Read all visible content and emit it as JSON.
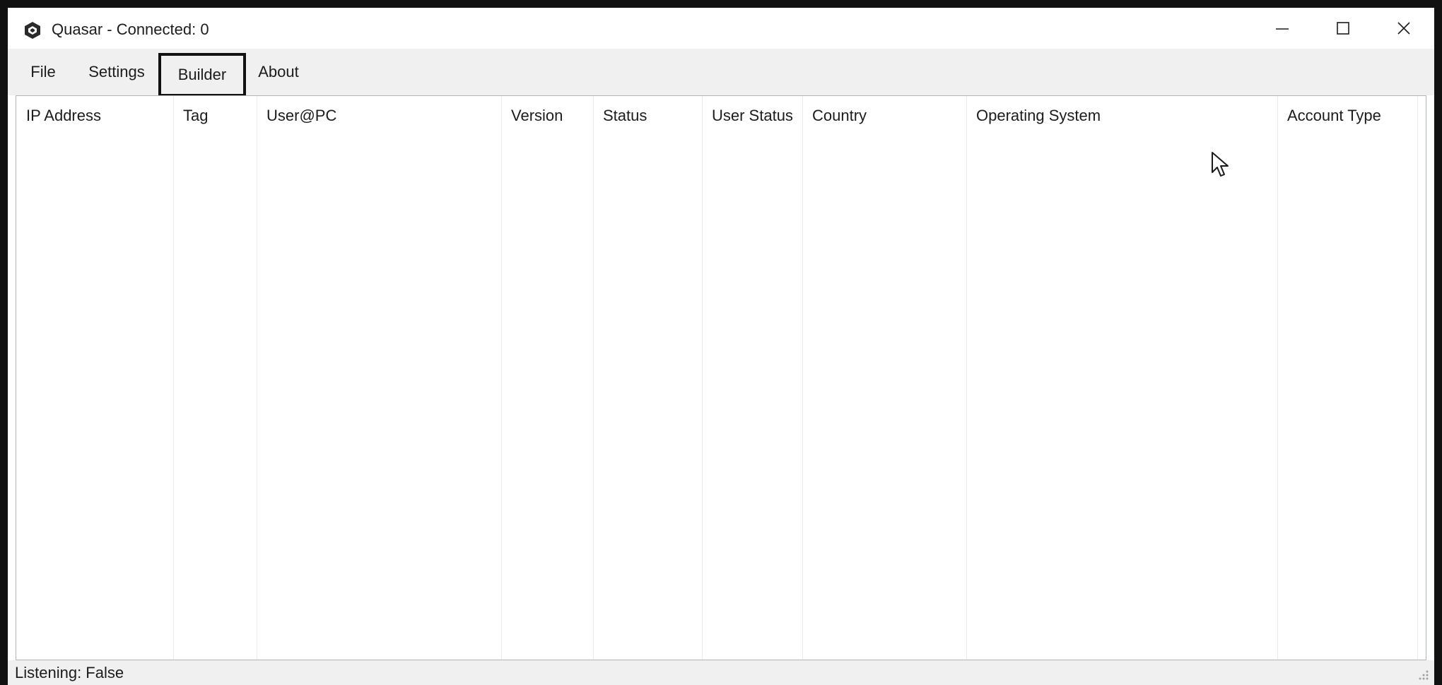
{
  "window": {
    "title": "Quasar - Connected: 0",
    "app_icon": "quasar-icon",
    "controls": [
      "minimize-icon",
      "maximize-icon",
      "close-icon"
    ]
  },
  "menu": {
    "items": [
      {
        "label": "File"
      },
      {
        "label": "Settings"
      },
      {
        "label": "Builder",
        "highlighted": true
      },
      {
        "label": "About"
      }
    ]
  },
  "clients_table": {
    "columns": [
      {
        "label": "IP Address"
      },
      {
        "label": "Tag"
      },
      {
        "label": "User@PC"
      },
      {
        "label": "Version"
      },
      {
        "label": "Status"
      },
      {
        "label": "User Status"
      },
      {
        "label": "Country"
      },
      {
        "label": "Operating System"
      },
      {
        "label": "Account Type"
      }
    ],
    "rows": []
  },
  "statusbar": {
    "text": "Listening: False"
  },
  "colors": {
    "menu_bg": "#f0f0f0",
    "highlight_border": "#111111",
    "window_bg": "#ffffff"
  }
}
